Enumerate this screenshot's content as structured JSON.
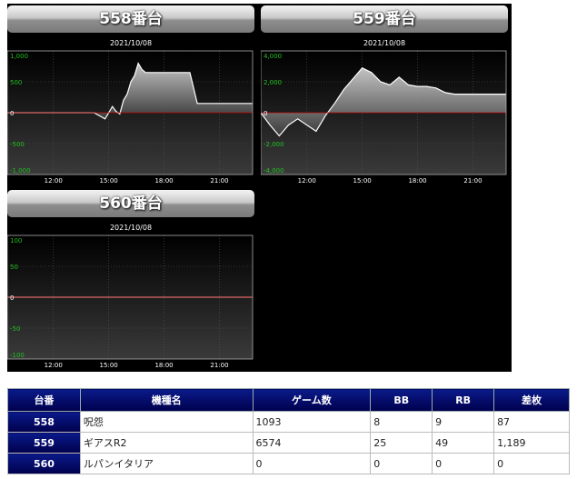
{
  "chart_data": [
    {
      "type": "area",
      "title": "558番台",
      "subtitle": "2021/10/08",
      "ylim": [
        -1000,
        1000
      ],
      "y_ticks": [
        1000,
        500,
        0,
        -500,
        -1000
      ],
      "y_tick_labels": [
        "1,000",
        "500",
        "0",
        "-500",
        "-1,000"
      ],
      "xlim": [
        9.5,
        22.8
      ],
      "x_ticks": [
        12,
        15,
        18,
        21
      ],
      "x_tick_labels": [
        "12:00",
        "15:00",
        "18:00",
        "21:00"
      ],
      "x": [
        9.5,
        14.2,
        14.5,
        14.8,
        15.0,
        15.2,
        15.4,
        15.6,
        15.8,
        16.0,
        16.2,
        16.4,
        16.6,
        16.8,
        17.0,
        18.0,
        19.0,
        19.4,
        19.8,
        22.8
      ],
      "y": [
        0,
        0,
        -50,
        -100,
        0,
        100,
        20,
        -20,
        200,
        300,
        500,
        600,
        800,
        700,
        650,
        650,
        650,
        650,
        150,
        150
      ],
      "accent_line": "#c80000",
      "positive_label_color": "#20c020"
    },
    {
      "type": "area",
      "title": "559番台",
      "subtitle": "2021/10/08",
      "ylim": [
        -4000,
        4000
      ],
      "y_ticks": [
        4000,
        2000,
        0,
        -2000,
        -4000
      ],
      "y_tick_labels": [
        "4,000",
        "2,000",
        "0",
        "-2,000",
        "-4,000"
      ],
      "xlim": [
        9.5,
        22.8
      ],
      "x_ticks": [
        12,
        15,
        18,
        21
      ],
      "x_tick_labels": [
        "12:00",
        "15:00",
        "18:00",
        "21:00"
      ],
      "x": [
        9.5,
        10.0,
        10.5,
        11.0,
        11.5,
        12.0,
        12.5,
        13.0,
        13.5,
        14.0,
        14.5,
        15.0,
        15.5,
        16.0,
        16.5,
        17.0,
        17.5,
        18.0,
        18.5,
        19.0,
        19.5,
        20.0,
        22.8
      ],
      "y": [
        0,
        -800,
        -1500,
        -800,
        -400,
        -800,
        -1200,
        -200,
        600,
        1500,
        2200,
        2900,
        2600,
        2000,
        1800,
        2300,
        1800,
        1700,
        1700,
        1600,
        1300,
        1200,
        1200
      ],
      "accent_line": "#c80000",
      "positive_label_color": "#20c020"
    },
    {
      "type": "area",
      "title": "560番台",
      "subtitle": "2021/10/08",
      "ylim": [
        -100,
        100
      ],
      "y_ticks": [
        100,
        50,
        0,
        -50,
        -100
      ],
      "y_tick_labels": [
        "100",
        "50",
        "0",
        "-50",
        "-100"
      ],
      "xlim": [
        9.5,
        22.8
      ],
      "x_ticks": [
        12,
        15,
        18,
        21
      ],
      "x_tick_labels": [
        "12:00",
        "15:00",
        "18:00",
        "21:00"
      ],
      "x": [
        9.5,
        22.8
      ],
      "y": [
        0,
        0
      ],
      "accent_line": "#c80000",
      "positive_label_color": "#20c020"
    }
  ],
  "table": {
    "headers": [
      "台番",
      "機種名",
      "ゲーム数",
      "BB",
      "RB",
      "差枚"
    ],
    "rows": [
      [
        "558",
        "呪怨",
        "1093",
        "8",
        "9",
        "87"
      ],
      [
        "559",
        "ギアスR2",
        "6574",
        "25",
        "49",
        "1,189"
      ],
      [
        "560",
        "ルパンイタリア",
        "0",
        "0",
        "0",
        "0"
      ]
    ]
  },
  "colors": {
    "header_bg": "#00007a",
    "panel_bg": "#000000"
  }
}
